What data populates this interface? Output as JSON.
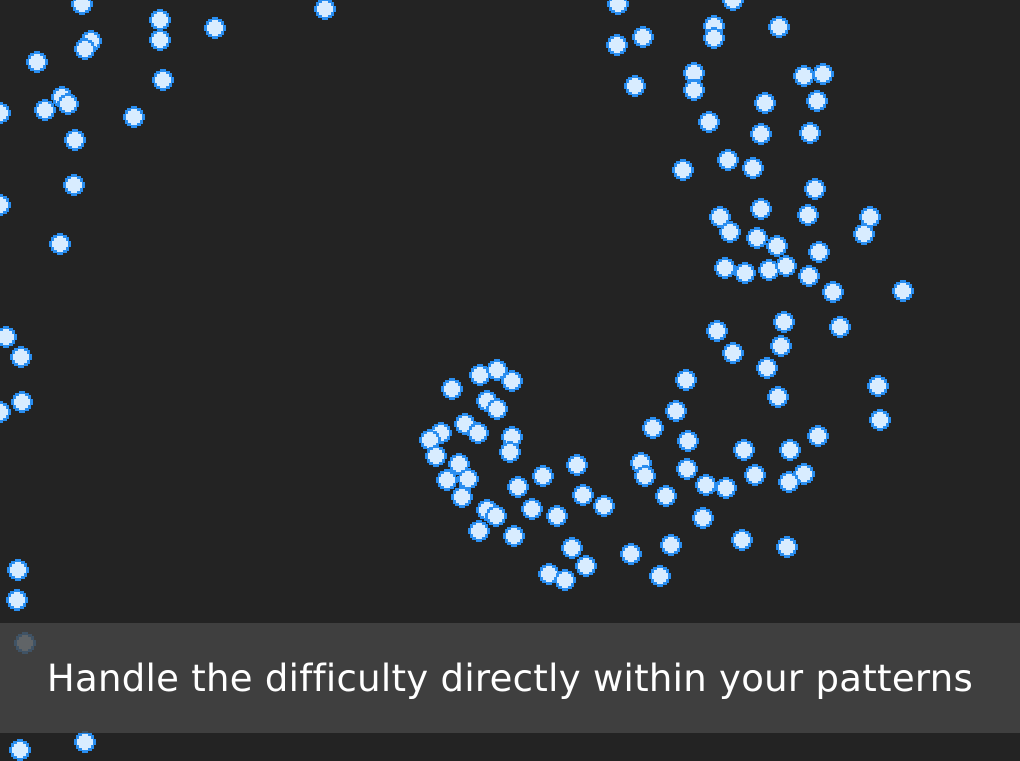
{
  "scene": {
    "background_color": "#232323",
    "bullet_icon": "diamond-bullet-icon",
    "bullet_core_color": "#d8ecff",
    "bullet_edge_color": "#2a8ef0"
  },
  "caption": {
    "text": "Handle the difficulty directly within your patterns",
    "bar_color": "#464646",
    "text_color": "#ffffff"
  }
}
